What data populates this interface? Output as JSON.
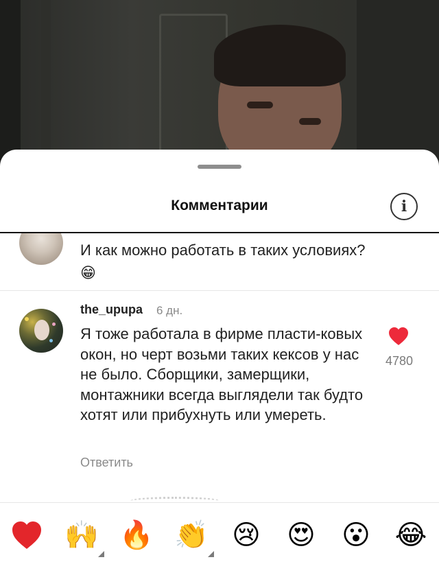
{
  "sheet": {
    "title": "Комментарии"
  },
  "comments": [
    {
      "text": "И как можно работать в таких условиях?😁"
    },
    {
      "username": "the_upupa",
      "time": "6 дн.",
      "text": "Я тоже работала в фирме пласти-ковых окон, но черт возьми таких кексов у нас не было. Сборщики, замерщики, монтажники всегда выглядели так будто хотят или прибухнуть или умереть.",
      "reply_label": "Ответить",
      "likes": "4780",
      "liked": true
    }
  ],
  "emoji_bar": [
    {
      "name": "red-heart-emoji",
      "glyph": "❤️"
    },
    {
      "name": "raising-hands-emoji",
      "glyph": "🙌"
    },
    {
      "name": "fire-emoji",
      "glyph": "🔥"
    },
    {
      "name": "clapping-hands-emoji",
      "glyph": "👏"
    },
    {
      "name": "crying-face-emoji",
      "glyph": "😢"
    },
    {
      "name": "heart-eyes-emoji",
      "glyph": "😍"
    },
    {
      "name": "surprised-face-emoji",
      "glyph": "😮"
    },
    {
      "name": "tears-of-joy-emoji",
      "glyph": "😂"
    }
  ],
  "colors": {
    "like_red": "#ed2a3b",
    "muted_text": "#8a8a8a"
  }
}
